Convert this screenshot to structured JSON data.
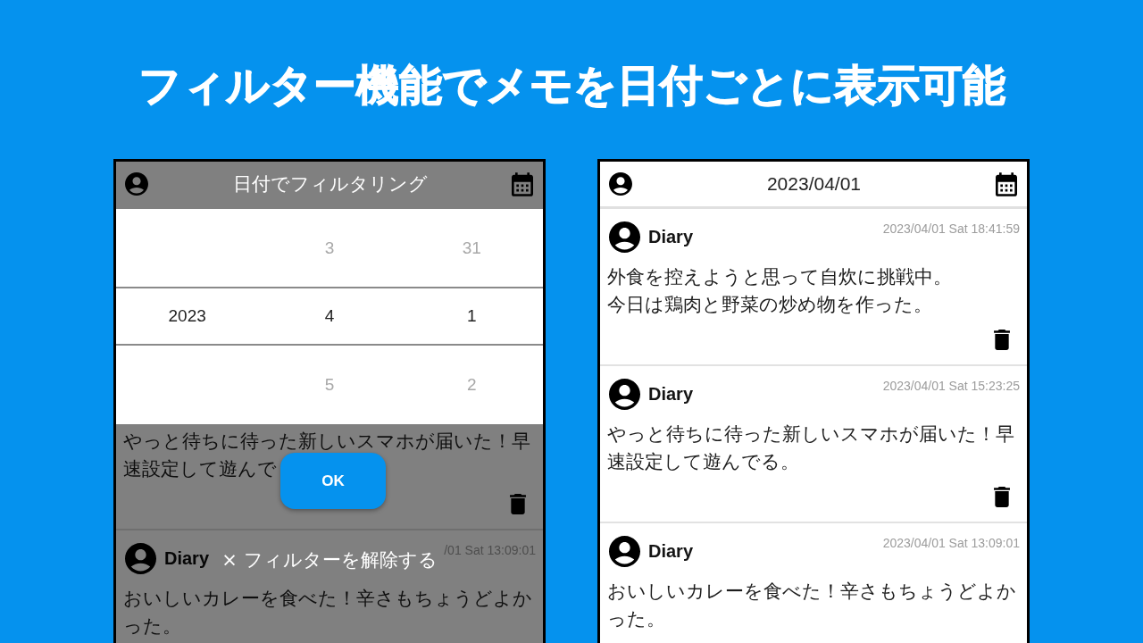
{
  "headline": "フィルター機能でメモを日付ごとに表示可能",
  "screens": [
    {
      "kind": "filter",
      "header": {
        "title": "日付でフィルタリング"
      },
      "picker": {
        "columns": [
          {
            "items": [
              {
                "label": "2023",
                "selected": true
              }
            ]
          },
          {
            "items": [
              {
                "label": "3",
                "selected": false
              },
              {
                "label": "4",
                "selected": true
              },
              {
                "label": "5",
                "selected": false
              }
            ]
          },
          {
            "items": [
              {
                "label": "31",
                "selected": false
              },
              {
                "label": "1",
                "selected": true
              },
              {
                "label": "2",
                "selected": false
              }
            ]
          }
        ]
      },
      "memos": [
        {
          "paragraphs": [
            "やっと待ちに待った新しいスマホが届いた！早",
            "速設定して遊んで"
          ]
        },
        {
          "name": "Diary",
          "timestamp": "/01 Sat 13:09:01",
          "paragraphs": [
            "おいしいカレーを食べた！辛さもちょうどよかった。"
          ]
        }
      ],
      "ok_button": "OK",
      "clear_filter": "× フィルターを解除する"
    },
    {
      "kind": "list",
      "header": {
        "title": "2023/04/01"
      },
      "memos": [
        {
          "name": "Diary",
          "timestamp": "2023/04/01 Sat 18:41:59",
          "paragraphs": [
            "外食を控えようと思って自炊に挑戦中。",
            "今日は鶏肉と野菜の炒め物を作った。"
          ]
        },
        {
          "name": "Diary",
          "timestamp": "2023/04/01 Sat 15:23:25",
          "paragraphs": [
            "やっと待ちに待った新しいスマホが届いた！早速設定して遊んでる。"
          ]
        },
        {
          "name": "Diary",
          "timestamp": "2023/04/01 Sat 13:09:01",
          "paragraphs": [
            "おいしいカレーを食べた！辛さもちょうどよかった。"
          ]
        }
      ]
    }
  ]
}
